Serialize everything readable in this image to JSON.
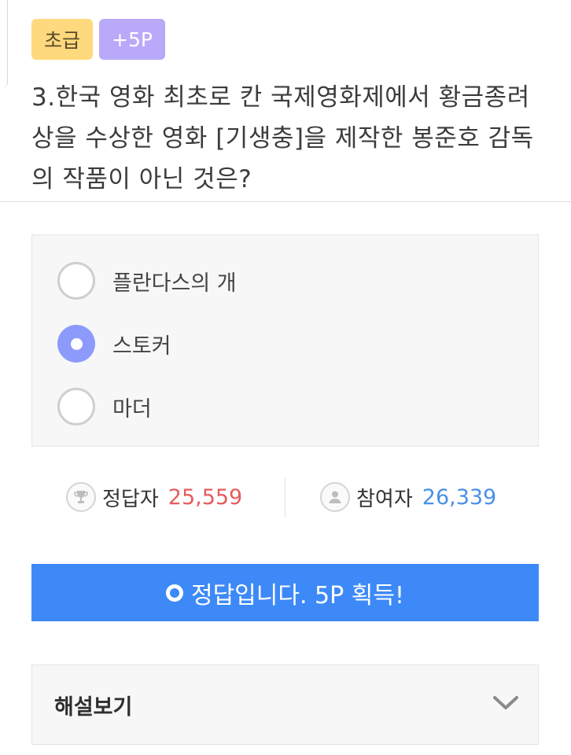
{
  "badges": {
    "level": "초급",
    "points": "+5P"
  },
  "question": {
    "text": "3.한국 영화 최초로 칸 국제영화제에서 황금종려상을 수상한 영화 [기생충]을 제작한 봉준호 감독의 작품이 아닌 것은?"
  },
  "options": [
    {
      "label": "플란다스의 개",
      "selected": false
    },
    {
      "label": "스토커",
      "selected": true
    },
    {
      "label": "마더",
      "selected": false
    }
  ],
  "stats": {
    "correct_label": "정답자",
    "correct_value": "25,559",
    "participants_label": "참여자",
    "participants_value": "26,339"
  },
  "result": {
    "label": "정답입니다. 5P 획득!"
  },
  "explanation": {
    "label": "해설보기"
  },
  "icons": {
    "correct": "trophy-icon",
    "participants": "person-icon",
    "result": "circle-icon",
    "expand": "chevron-down-icon"
  },
  "colors": {
    "level_badge": "#ffd97d",
    "points_badge": "#b9a9f9",
    "selected_radio": "#8c9bfb",
    "correct_count": "#e65c5c",
    "participants_count": "#4a8fe7",
    "result_button": "#3d89f7"
  }
}
